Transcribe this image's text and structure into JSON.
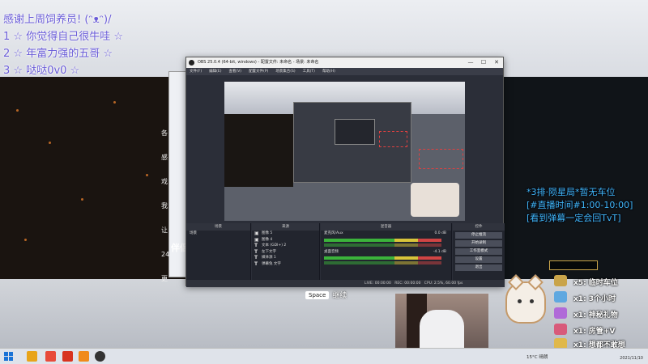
{
  "overlay": {
    "welcome_lines": [
      "感谢上周饲养员! (ᵔᴥᵔ)/",
      "1  ☆ 你觉得自己很牛哇 ☆",
      "2  ☆ 年富力强的五哥  ☆",
      "3  ☆  哒哒0v0  ☆"
    ],
    "side_chars": [
      "各",
      "感",
      "戏",
      "我",
      "让",
      "24",
      "更"
    ],
    "partner_text": "伴侣",
    "schedule_lines": [
      "*3排·陨星局*暂无车位",
      "[#直播时间#1:00-10:00]",
      "[看到弹幕一定会回TvT]"
    ],
    "gifts": [
      {
        "text": "x5: 临时车位",
        "color": "#c9a44a"
      },
      {
        "text": "x1: 3个小时",
        "color": "#5fa8e0"
      },
      {
        "text": "x1: 神秘礼物",
        "color": "#b06ad8"
      },
      {
        "text": "x1: 房管+V",
        "color": "#d85a7a"
      },
      {
        "text": "x1: 想都不敢想",
        "color": "#e0b84a"
      }
    ]
  },
  "obs": {
    "title": "OBS 25.0.4 (64-bit, windows) - 配置文件: 未命名 - 场景: 未命名",
    "window_controls": [
      "—",
      "☐",
      "✕"
    ],
    "menu": [
      "文件(F)",
      "编辑(E)",
      "查看(V)",
      "配置文件(P)",
      "场景集合(S)",
      "工具(T)",
      "帮助(H)"
    ],
    "docks": {
      "scenes": {
        "header": "场景",
        "items": [
          "场景"
        ]
      },
      "sources": {
        "header": "来源",
        "items": [
          "图像 5",
          "图像 4",
          "文本 (GDI+) 2",
          "左下文字",
          "媒体源 1",
          "弹幕兔 文字"
        ]
      },
      "mixer": {
        "header": "混音器",
        "channels": [
          "麦克风/Aux",
          "桌面音频"
        ],
        "levels": [
          "0.0 dB",
          "-4.1 dB"
        ]
      },
      "controls": {
        "header": "控件",
        "buttons": [
          "停止推流",
          "开始录制",
          "工作室模式",
          "设置",
          "退出"
        ]
      }
    },
    "status_bar": {
      "live": "LIVE: 00:00:00",
      "rec": "REC: 00:00:00",
      "cpu": "CPU: 2.5%, 60.00 fps"
    }
  },
  "hint": {
    "key": "Space",
    "label": "继续"
  },
  "taskbar": {
    "weather": "15°C 晴朗",
    "time": "2021/11/10"
  },
  "colors": {
    "schedule_text": "#3fb6f5",
    "welcome_text": "#6a5cd8",
    "obs_bg": "#2b2e38"
  }
}
